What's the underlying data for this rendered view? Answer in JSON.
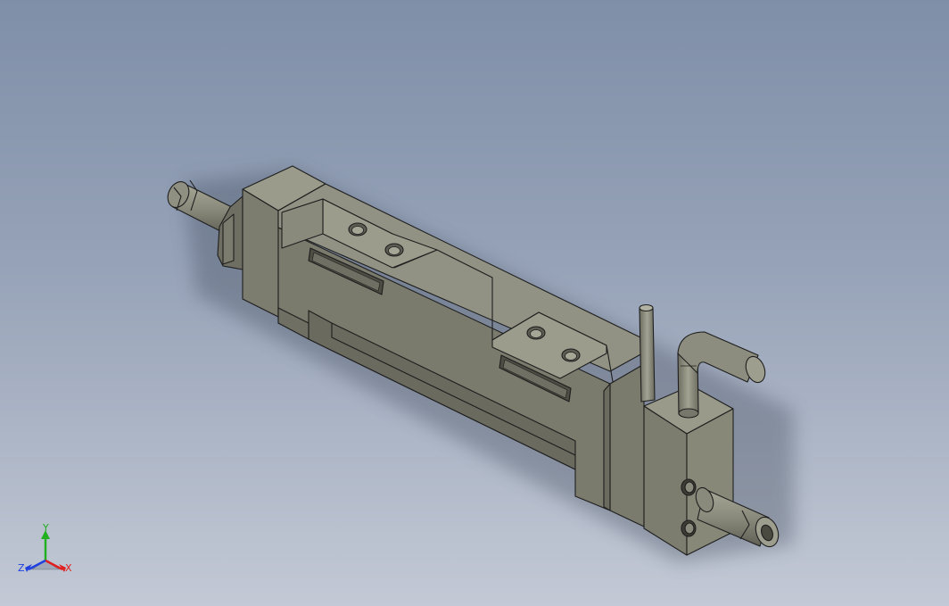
{
  "viewport": {
    "background_top": "#7f8fa8",
    "background_bottom": "#c3c9d5",
    "model_color": "#7d7d6f",
    "edge_color": "#1e1e1e"
  },
  "triad": {
    "x_label": "X",
    "y_label": "Y",
    "z_label": "Z",
    "x_color": "#e02020",
    "y_color": "#20b020",
    "z_color": "#2040e0"
  }
}
